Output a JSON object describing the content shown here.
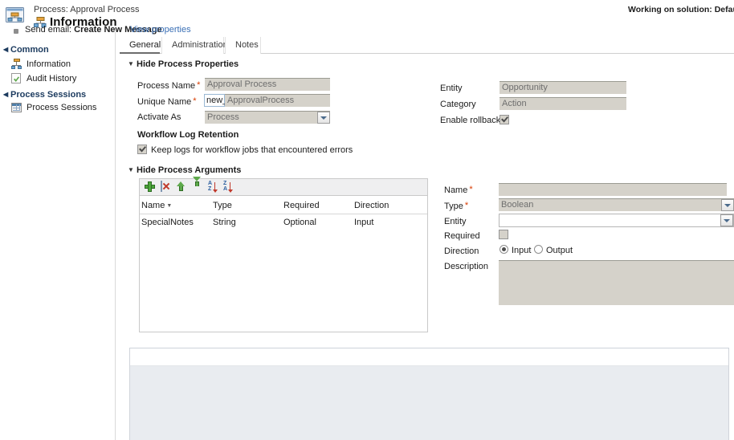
{
  "header": {
    "subtitle": "Process: Approval Process",
    "title": "Information",
    "solution_status": "Working on solution: Default So"
  },
  "sidebar": {
    "groups": [
      {
        "label": "Common",
        "items": [
          {
            "label": "Information",
            "icon": "sitemap-icon"
          },
          {
            "label": "Audit History",
            "icon": "audit-doc-icon"
          }
        ]
      },
      {
        "label": "Process Sessions",
        "items": [
          {
            "label": "Process Sessions",
            "icon": "grid-icon"
          }
        ]
      }
    ]
  },
  "tabs": [
    {
      "label": "General",
      "selected": true
    },
    {
      "label": "Administration",
      "selected": false
    },
    {
      "label": "Notes",
      "selected": false
    }
  ],
  "process_properties": {
    "section_label": "Hide Process Properties",
    "process_name_label": "Process Name",
    "process_name_value": "Approval Process",
    "unique_name_label": "Unique Name",
    "unique_name_prefix": "new_",
    "unique_name_value": "ApprovalProcess",
    "activate_as_label": "Activate As",
    "activate_as_value": "Process",
    "entity_label": "Entity",
    "entity_value": "Opportunity",
    "category_label": "Category",
    "category_value": "Action",
    "enable_rollback_label": "Enable rollback",
    "enable_rollback_checked": true,
    "log_retention_heading": "Workflow Log Retention",
    "keep_logs_label": "Keep logs for workflow jobs that encountered errors",
    "keep_logs_checked": true
  },
  "process_arguments": {
    "section_label": "Hide Process Arguments",
    "toolbar": [
      {
        "name": "add-argument-button",
        "icon": "green-plus-icon"
      },
      {
        "name": "delete-argument-button",
        "icon": "delete-document-icon"
      },
      {
        "name": "move-up-button",
        "icon": "green-up-arrow-icon"
      },
      {
        "name": "move-down-button",
        "icon": "green-down-arrow-icon"
      },
      {
        "name": "sort-ascending-button",
        "icon": "sort-az-icon"
      },
      {
        "name": "sort-descending-button",
        "icon": "sort-za-icon"
      }
    ],
    "columns": [
      "Name",
      "Type",
      "Required",
      "Direction"
    ],
    "rows": [
      {
        "name": "SpecialNotes",
        "type": "String",
        "required": "Optional",
        "direction": "Input"
      }
    ],
    "detail": {
      "name_label": "Name",
      "name_value": "",
      "type_label": "Type",
      "type_value": "Boolean",
      "entity_label": "Entity",
      "entity_value": "",
      "required_label": "Required",
      "required_checked": false,
      "direction_label": "Direction",
      "direction_input_label": "Input",
      "direction_output_label": "Output",
      "direction_selected": "Input",
      "description_label": "Description",
      "description_value": ""
    }
  },
  "step_panel": {
    "bullet_label": "Send email:",
    "step_label": "Create New Message",
    "link_label": "View properties"
  },
  "colors": {
    "accent_link": "#3a6fb5",
    "required_star": "#d83b01",
    "field_disabled_bg": "#d5d2ca",
    "group_heading": "#1b3a5e",
    "panel_bg": "#e9ecf0"
  }
}
